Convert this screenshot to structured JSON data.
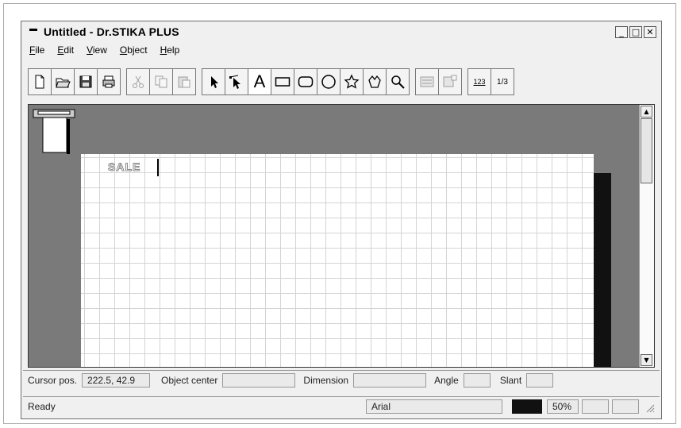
{
  "window": {
    "title": "Untitled - Dr.STIKA PLUS"
  },
  "window_controls": {
    "minimize": "_",
    "maximize": "□",
    "close": "✕"
  },
  "menu": [
    {
      "key": "F",
      "rest": "ile"
    },
    {
      "key": "E",
      "rest": "dit"
    },
    {
      "key": "V",
      "rest": "iew"
    },
    {
      "key": "O",
      "rest": "bject"
    },
    {
      "key": "H",
      "rest": "elp"
    }
  ],
  "toolbar": {
    "text_tool_label": "A",
    "view_123_label": "123",
    "fraction_label": "1/3"
  },
  "canvas": {
    "text_object": "SALE"
  },
  "status": {
    "cursor_label": "Cursor pos.",
    "cursor_value": "222.5, 42.9",
    "object_center_label": "Object center",
    "object_center_value": "",
    "dimension_label": "Dimension",
    "dimension_value": "",
    "angle_label": "Angle",
    "angle_value": "",
    "slant_label": "Slant",
    "slant_value": "",
    "ready": "Ready",
    "font": "Arial",
    "zoom": "50%",
    "color_swatch": "#111111"
  }
}
